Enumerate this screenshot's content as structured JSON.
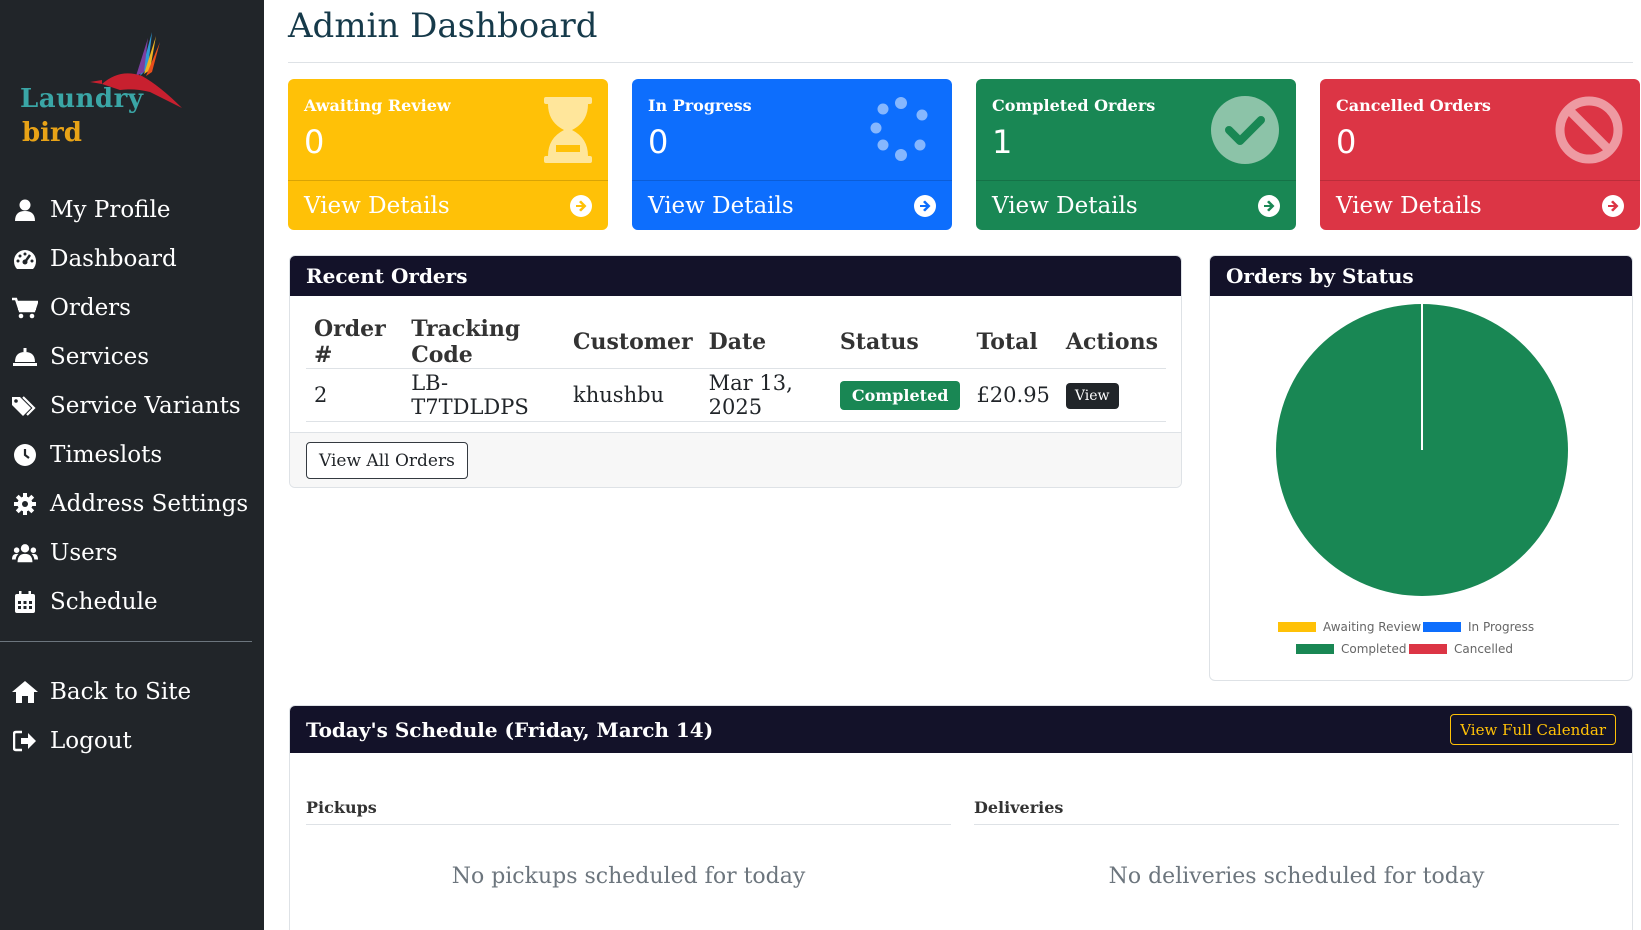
{
  "brand": {
    "word1": "Laundry",
    "word2": "bird"
  },
  "sidebar": {
    "items": [
      {
        "label": "My Profile",
        "icon": "user-icon"
      },
      {
        "label": "Dashboard",
        "icon": "tachometer-icon"
      },
      {
        "label": "Orders",
        "icon": "cart-icon"
      },
      {
        "label": "Services",
        "icon": "bell-icon"
      },
      {
        "label": "Service Variants",
        "icon": "tags-icon"
      },
      {
        "label": "Timeslots",
        "icon": "clock-icon"
      },
      {
        "label": "Address Settings",
        "icon": "gear-icon"
      },
      {
        "label": "Users",
        "icon": "users-icon"
      },
      {
        "label": "Schedule",
        "icon": "calendar-icon"
      }
    ],
    "bottom_items": [
      {
        "label": "Back to Site",
        "icon": "home-icon"
      },
      {
        "label": "Logout",
        "icon": "logout-icon"
      }
    ]
  },
  "page": {
    "title": "Admin Dashboard"
  },
  "stats": [
    {
      "label": "Awaiting Review",
      "value": "0",
      "link": "View Details",
      "color": "#ffc107",
      "icon": "hourglass-icon"
    },
    {
      "label": "In Progress",
      "value": "0",
      "link": "View Details",
      "color": "#0d6efd",
      "icon": "spinner-icon"
    },
    {
      "label": "Completed Orders",
      "value": "1",
      "link": "View Details",
      "color": "#198754",
      "icon": "check-circle-icon"
    },
    {
      "label": "Cancelled Orders",
      "value": "0",
      "link": "View Details",
      "color": "#dc3545",
      "icon": "ban-icon"
    }
  ],
  "recent_orders": {
    "title": "Recent Orders",
    "columns": [
      "Order #",
      "Tracking Code",
      "Customer",
      "Date",
      "Status",
      "Total",
      "Actions"
    ],
    "rows": [
      {
        "order": "2",
        "tracking": "LB-T7TDLDPS",
        "customer": "khushbu",
        "date": "Mar 13, 2025",
        "status": "Completed",
        "total": "£20.95",
        "action": "View"
      }
    ],
    "view_all": "View All Orders"
  },
  "orders_by_status": {
    "title": "Orders by Status"
  },
  "chart_data": {
    "type": "pie",
    "categories": [
      "Awaiting Review",
      "In Progress",
      "Completed",
      "Cancelled"
    ],
    "values": [
      0,
      0,
      1,
      0
    ],
    "colors": [
      "#ffc107",
      "#0d6efd",
      "#198754",
      "#dc3545"
    ],
    "legend_position": "bottom"
  },
  "schedule": {
    "title": "Today's Schedule (Friday, March 14)",
    "calendar_button": "View Full Calendar",
    "pickups_title": "Pickups",
    "pickups_empty": "No pickups scheduled for today",
    "deliveries_title": "Deliveries",
    "deliveries_empty": "No deliveries scheduled for today"
  }
}
